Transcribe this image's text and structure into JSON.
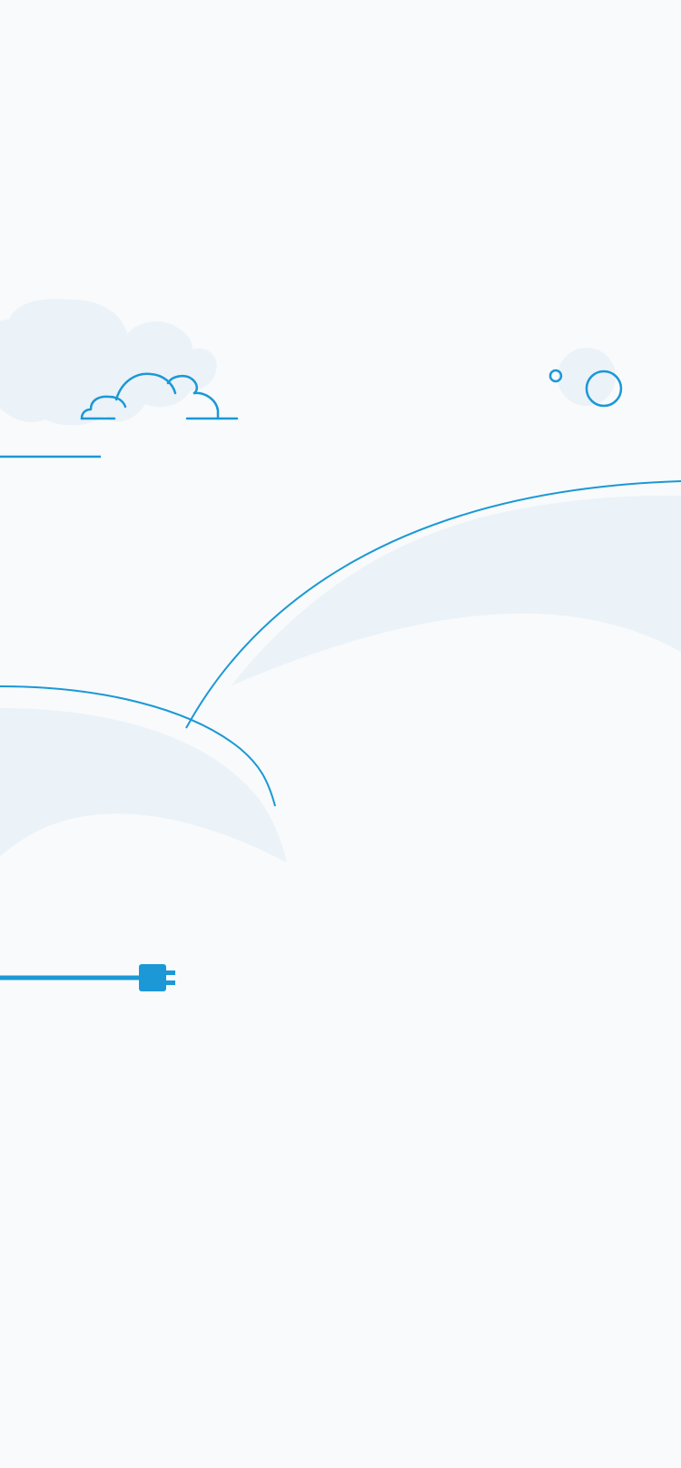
{
  "page": {
    "background_color": "#f8fafc"
  },
  "illustration": {
    "type": "disconnected-plug",
    "stroke_color": "#1b98d5",
    "fill_light_color": "#ebf2f8",
    "icons": [
      "cloud-icon",
      "bubble-icon",
      "cable-icon",
      "plug-icon"
    ]
  }
}
